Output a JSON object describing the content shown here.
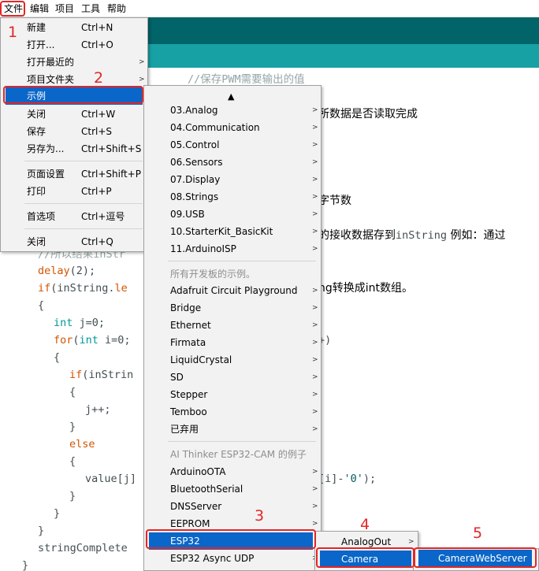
{
  "menubar": [
    "文件",
    "编辑",
    "项目",
    "工具",
    "帮助"
  ],
  "file_menu": [
    {
      "label": "新建",
      "accel": "Ctrl+N"
    },
    {
      "label": "打开...",
      "accel": "Ctrl+O"
    },
    {
      "label": "打开最近的",
      "submenu": true
    },
    {
      "label": "项目文件夹",
      "submenu": true
    },
    {
      "label": "示例",
      "submenu": true,
      "selected": true
    },
    {
      "label": "关闭",
      "accel": "Ctrl+W"
    },
    {
      "label": "保存",
      "accel": "Ctrl+S"
    },
    {
      "label": "另存为...",
      "accel": "Ctrl+Shift+S"
    },
    {
      "label": "页面设置",
      "accel": "Ctrl+Shift+P"
    },
    {
      "label": "打印",
      "accel": "Ctrl+P"
    },
    {
      "label": "首选项",
      "accel": "Ctrl+逗号"
    },
    {
      "label": "关闭",
      "accel": "Ctrl+Q"
    }
  ],
  "examples_menu": {
    "scroll_up": "▲",
    "builtin": [
      "03.Analog",
      "04.Communication",
      "05.Control",
      "06.Sensors",
      "07.Display",
      "08.Strings",
      "09.USB",
      "10.StarterKit_BasicKit",
      "11.ArduinoISP"
    ],
    "all_boards_header": "所有开发板的示例。",
    "all_boards": [
      "Adafruit Circuit Playground",
      "Bridge",
      "Ethernet",
      "Firmata",
      "LiquidCrystal",
      "SD",
      "Stepper",
      "Temboo",
      "已弃用"
    ],
    "board_header": "AI Thinker ESP32-CAM 的例子",
    "board": [
      "ArduinoOTA",
      "BluetoothSerial",
      "DNSServer",
      "EEPROM",
      "ESP32",
      "ESP32 Async UDP"
    ]
  },
  "esp32_menu": [
    "AnalogOut",
    "Camera"
  ],
  "camera_menu": [
    "CameraWebServer"
  ],
  "code": {
    "l1": "//保存PWM需要输出的值",
    "l2": "所数据是否读取完成",
    "l3": "字节数",
    "l4a": "的接收数据存到",
    "l4b": "inString",
    "l4c": " 例如：通过",
    "l5": "//所以结果inStr",
    "l6a": "delay",
    "l6b": "(2);",
    "l7a": "if",
    "l7b": "(inString.",
    "l7c": "le",
    "l8": "ng转换成int数组。",
    "l9": "{",
    "l10a": "int",
    "l10b": " j=0;",
    "l11a": "for",
    "l11b": "(",
    "l11c": "int",
    "l11d": " i=0;",
    "l11e": "+)",
    "l12": "{",
    "l13a": "if",
    "l13b": "(inStrin",
    "l14": "{",
    "l15": "j++;",
    "l16": "}",
    "l17": "else",
    "l18": "{",
    "l19a": "value[j]",
    "l19b": "[i]-",
    "l19c": "'0'",
    "l19d": ");",
    "l20": "}",
    "l21": "}",
    "l22": "}",
    "l23": "stringComplete",
    "l24": "}"
  },
  "steps": [
    "1",
    "2",
    "3",
    "4",
    "5"
  ],
  "colors": {
    "teal_dark": "#006468",
    "teal": "#17a1a5",
    "selection": "#0a66c8",
    "highlight": "#e32626"
  }
}
